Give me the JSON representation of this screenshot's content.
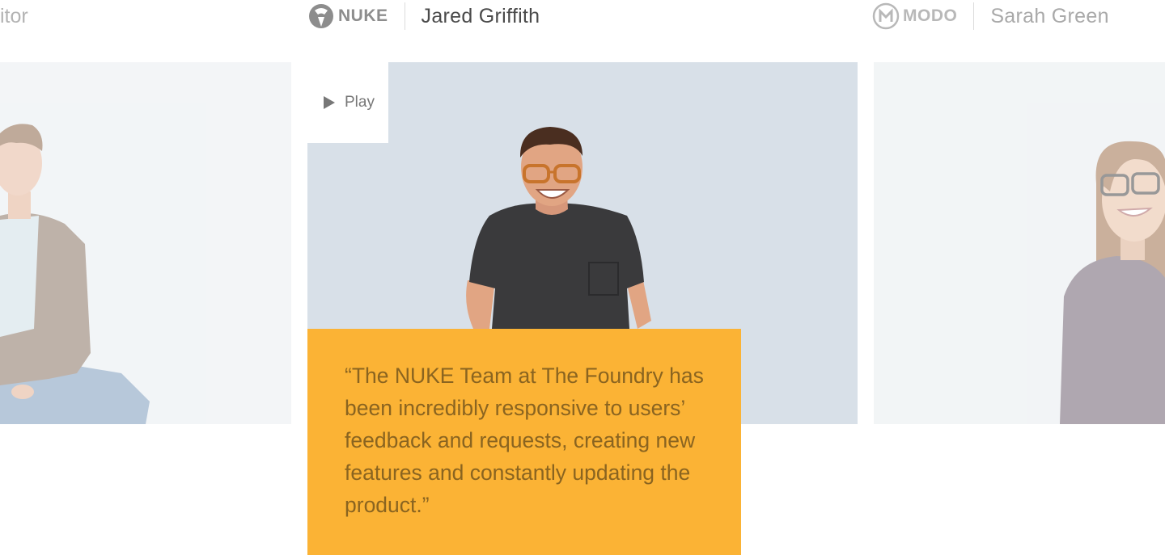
{
  "slides": [
    {
      "partial_title": "itor",
      "colors": {
        "background": "#e9edf1",
        "jacket": "#8a7464",
        "shirt": "#cfdfe7",
        "jeans": "#7e9cbc",
        "skin": "#e7b9a0",
        "hair": "#8c6548"
      }
    },
    {
      "brand": {
        "name": "NUKE",
        "icon": "nuke-logo-icon"
      },
      "person_name": "Jared Griffith",
      "play_label": "Play",
      "quote": "“The NUKE Team at The Foundry has been incredibly responsive to users’ feedback and requests, creating new features and constantly updating the product.”",
      "colors": {
        "background": "#d8e0e8",
        "shirt": "#3a3a3c",
        "skin": "#e1a583",
        "hair": "#4a2e20",
        "glasses": "#c8742c",
        "quote_box": "#fbb335",
        "quote_text": "#8a6420"
      }
    },
    {
      "brand": {
        "name": "MODO",
        "icon": "modo-logo-icon"
      },
      "person_name": "Sarah Green",
      "colors": {
        "background": "#e8ecef",
        "sweater": "#6e6170",
        "hair": "#a0704c",
        "skin": "#e8c0a4"
      }
    }
  ],
  "colors": {
    "header_text_dim": "#a9a9a9",
    "header_text": "#4a4a4a",
    "play_icon": "#777777"
  }
}
